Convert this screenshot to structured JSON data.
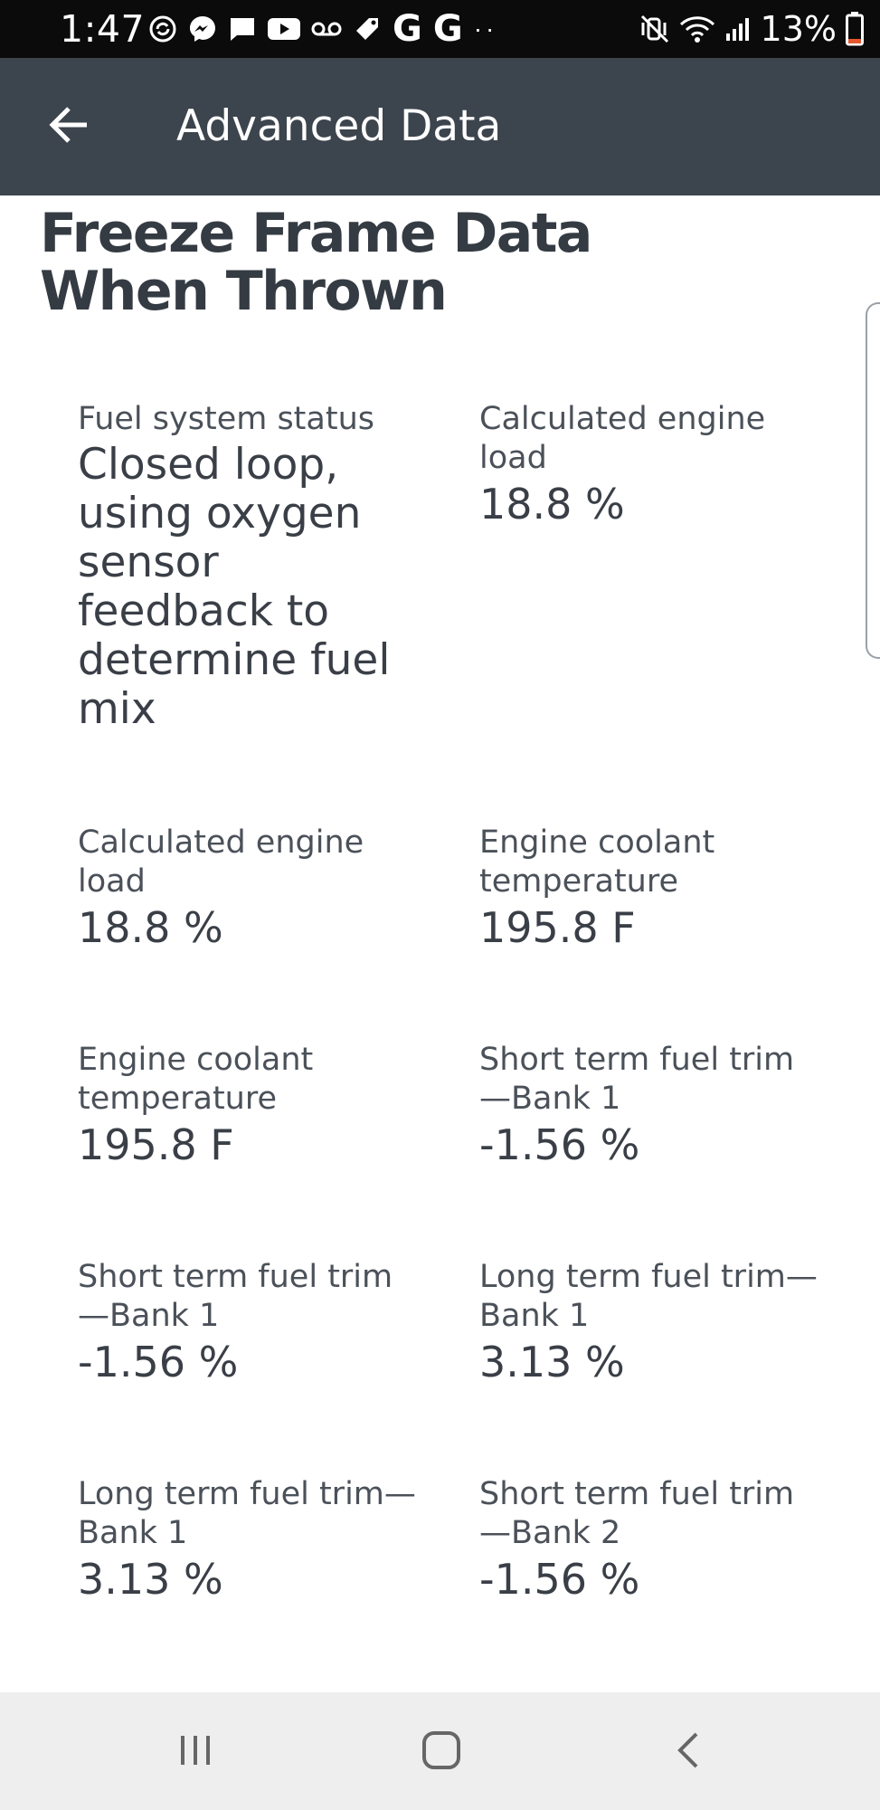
{
  "status_bar": {
    "time": "1:47",
    "left_icons": [
      "sync-icon",
      "messenger-icon",
      "chat-icon",
      "youtube-icon",
      "voicemail-icon",
      "tag-icon",
      "google-icon",
      "google-icon"
    ],
    "g_letter": "G",
    "dots": "··",
    "right_icons": [
      "mute-icon",
      "wifi-icon",
      "signal-icon",
      "battery-icon"
    ],
    "battery_percent": "13%"
  },
  "app_bar": {
    "back_icon": "arrow-left-icon",
    "title": "Advanced Data"
  },
  "section": {
    "title": "Freeze Frame Data When Thrown"
  },
  "grid": [
    {
      "label": "Fuel system status",
      "value": "Closed loop, using oxygen sensor feedback to determine fuel mix"
    },
    {
      "label": "Calculated engine load",
      "value": "18.8 %"
    },
    {
      "label": "Calculated engine load",
      "value": "18.8 %"
    },
    {
      "label": "Engine coolant temperature",
      "value": "195.8 F"
    },
    {
      "label": "Engine coolant temperature",
      "value": "195.8 F"
    },
    {
      "label": "Short term fuel trim—Bank 1",
      "value": "-1.56 %"
    },
    {
      "label": "Short term fuel trim—Bank 1",
      "value": "-1.56 %"
    },
    {
      "label": "Long term fuel trim—Bank 1",
      "value": "3.13 %"
    },
    {
      "label": "Long term fuel trim—Bank 1",
      "value": "3.13 %"
    },
    {
      "label": "Short term fuel trim—Bank 2",
      "value": "-1.56 %"
    }
  ],
  "nav_bar": {
    "items": [
      "recent-apps-icon",
      "home-icon",
      "back-icon"
    ]
  },
  "colors": {
    "app_bar_bg": "#3c444d",
    "status_bar_bg": "#0b0b0b",
    "nav_bar_bg": "#eeeeee",
    "battery_low": "#e4572e"
  }
}
